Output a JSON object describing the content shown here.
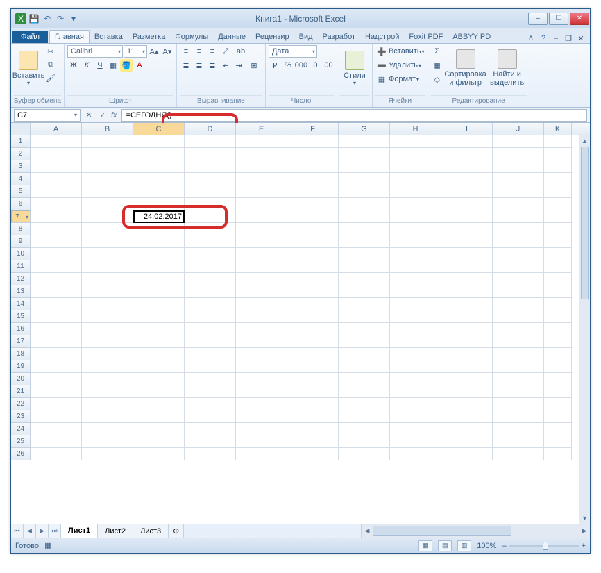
{
  "title": "Книга1 - Microsoft Excel",
  "qat_icons": [
    "excel",
    "save",
    "undo",
    "redo",
    "print",
    "down"
  ],
  "window_buttons": {
    "min": "–",
    "max": "☐",
    "close": "✕",
    "doc_min": "–",
    "doc_restore": "❐",
    "doc_close": "✕"
  },
  "file_tab": "Файл",
  "tabs": [
    "Главная",
    "Вставка",
    "Разметка",
    "Формулы",
    "Данные",
    "Рецензир",
    "Вид",
    "Разработ",
    "Надстрой",
    "Foxit PDF",
    "ABBYY PD"
  ],
  "active_tab": 0,
  "help_icons": [
    "ⓘ",
    "?",
    "–",
    "❐",
    "✕"
  ],
  "ribbon": {
    "clipboard": {
      "label": "Буфер обмена",
      "paste": "Вставить",
      "icons": [
        "cut",
        "copy",
        "format-painter"
      ]
    },
    "font": {
      "label": "Шрифт",
      "name": "Calibri",
      "size": "11",
      "rows": [
        [
          "Ж",
          "К",
          "Ч",
          "▾",
          "▦",
          "▾"
        ],
        [
          "🖉",
          "A",
          "▾",
          "▲",
          "▾"
        ]
      ]
    },
    "align": {
      "label": "Выравнивание",
      "rows": [
        [
          "≡",
          "≡",
          "≡",
          "≫",
          "ab↔"
        ],
        [
          "≣",
          "≣",
          "≣",
          "⇤",
          "⇥",
          "⊞"
        ]
      ]
    },
    "number": {
      "label": "Число",
      "format": "Дата",
      "rows": [
        [
          "₽",
          "%",
          "000",
          ".0",
          ".00"
        ]
      ]
    },
    "styles": {
      "label": "",
      "btn": "Стили"
    },
    "cells": {
      "label": "Ячейки",
      "items": [
        "Вставить",
        "Удалить",
        "Формат"
      ]
    },
    "editing": {
      "label": "Редактирование",
      "sigma": "Σ",
      "fill": "▦",
      "clear": "◇",
      "sort": "Сортировка и фильтр",
      "find": "Найти и выделить"
    }
  },
  "formula_bar": {
    "name_box": "C7",
    "fx": "fx",
    "formula": "=СЕГОДНЯ()"
  },
  "columns": [
    "A",
    "B",
    "C",
    "D",
    "E",
    "F",
    "G",
    "H",
    "I",
    "J",
    "K"
  ],
  "selected_column": "C",
  "row_count": 26,
  "selected_row": 7,
  "cell_value": "24.02.2017",
  "sheets": {
    "nav": [
      "⏮",
      "◀",
      "▶",
      "⏭"
    ],
    "tabs": [
      "Лист1",
      "Лист2",
      "Лист3"
    ],
    "active": 0,
    "add_icon": "⊕"
  },
  "status": {
    "ready": "Готово",
    "macro_icon": "▦",
    "views": [
      "▦",
      "▤",
      "▥"
    ],
    "zoom": "100%",
    "zoom_minus": "–",
    "zoom_plus": "+"
  }
}
